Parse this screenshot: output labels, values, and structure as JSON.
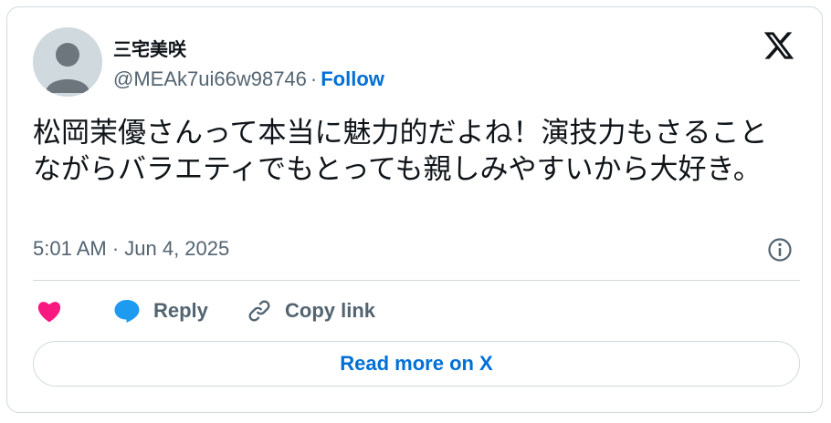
{
  "author": {
    "display_name": "三宅美咲",
    "handle": "@MEAk7ui66w98746",
    "separator": "·",
    "follow_label": "Follow",
    "avatar_icon": "default-avatar-icon"
  },
  "brand": {
    "logo_icon": "x-logo-icon"
  },
  "tweet": {
    "text": "松岡茉優さんって本当に魅力的だよね！演技力もさることながらバラエティでもとっても親しみやすいから大好き。",
    "timestamp": "5:01 AM · Jun 4, 2025",
    "info_icon": "info-icon"
  },
  "actions": {
    "like_icon": "heart-icon",
    "reply_icon": "speech-bubble-icon",
    "reply_label": "Reply",
    "copy_icon": "link-icon",
    "copy_label": "Copy link"
  },
  "footer": {
    "read_more_label": "Read more on X"
  },
  "colors": {
    "link_blue": "#006fd6",
    "heart_pink": "#f91880",
    "reply_blue": "#1d9bf0",
    "muted_text": "#536471",
    "border": "#cfd9de"
  }
}
